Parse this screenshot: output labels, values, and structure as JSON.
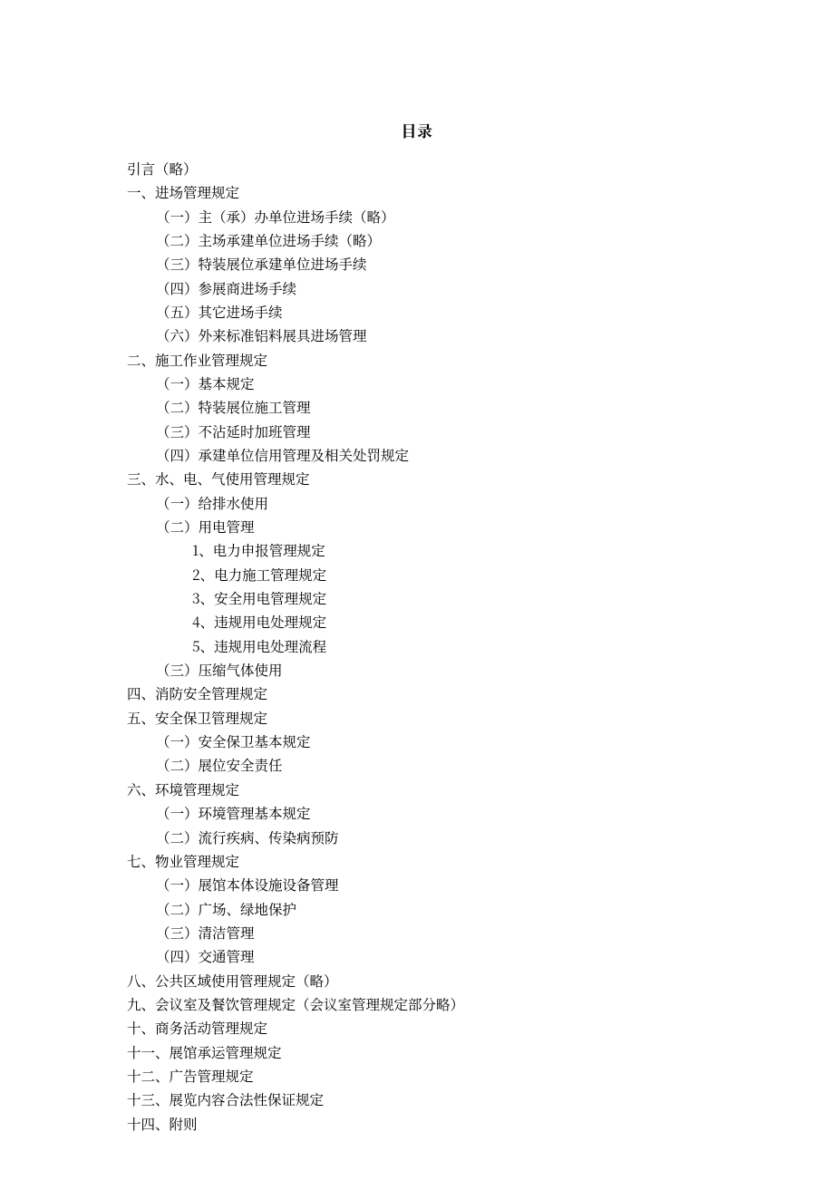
{
  "title": "目录",
  "toc": [
    {
      "level": 0,
      "text": "引言（略）"
    },
    {
      "level": 0,
      "text": "一、进场管理规定"
    },
    {
      "level": 1,
      "text": "（一）主（承）办单位进场手续（略）"
    },
    {
      "level": 1,
      "text": "（二）主场承建单位进场手续（略）"
    },
    {
      "level": 1,
      "text": "（三）特装展位承建单位进场手续"
    },
    {
      "level": 1,
      "text": "（四）参展商进场手续"
    },
    {
      "level": 1,
      "text": "（五）其它进场手续"
    },
    {
      "level": 1,
      "text": "（六）外来标准铝料展具进场管理"
    },
    {
      "level": 0,
      "text": "二、施工作业管理规定"
    },
    {
      "level": 1,
      "text": "（一）基本规定"
    },
    {
      "level": 1,
      "text": "（二）特装展位施工管理"
    },
    {
      "level": 1,
      "text": "（三）不沾延时加班管理"
    },
    {
      "level": 1,
      "text": "（四）承建单位信用管理及相关处罚规定"
    },
    {
      "level": 0,
      "text": "三、水、电、气使用管理规定"
    },
    {
      "level": 1,
      "text": "（一）给排水使用"
    },
    {
      "level": 1,
      "text": "（二）用电管理"
    },
    {
      "level": 2,
      "text": "1、电力申报管理规定"
    },
    {
      "level": 2,
      "text": "2、电力施工管理规定"
    },
    {
      "level": 2,
      "text": "3、安全用电管理规定"
    },
    {
      "level": 2,
      "text": "4、违规用电处理规定"
    },
    {
      "level": 2,
      "text": "5、违规用电处理流程"
    },
    {
      "level": 1,
      "text": "（三）压缩气体使用"
    },
    {
      "level": 0,
      "text": "四、消防安全管理规定"
    },
    {
      "level": 0,
      "text": "五、安全保卫管理规定"
    },
    {
      "level": 1,
      "text": "（一）安全保卫基本规定"
    },
    {
      "level": 1,
      "text": "（二）展位安全责任"
    },
    {
      "level": 0,
      "text": "六、环境管理规定"
    },
    {
      "level": 1,
      "text": "（一）环境管理基本规定"
    },
    {
      "level": 1,
      "text": "（二）流行疾病、传染病预防"
    },
    {
      "level": 0,
      "text": "七、物业管理规定"
    },
    {
      "level": 1,
      "text": "（一）展馆本体设施设备管理"
    },
    {
      "level": 1,
      "text": "（二）广场、绿地保护"
    },
    {
      "level": 1,
      "text": "（三）清洁管理"
    },
    {
      "level": 1,
      "text": "（四）交通管理"
    },
    {
      "level": 0,
      "text": "八、公共区域使用管理规定（略）"
    },
    {
      "level": 0,
      "text": "九、会议室及餐饮管理规定（会议室管理规定部分略）"
    },
    {
      "level": 0,
      "text": "十、商务活动管理规定"
    },
    {
      "level": 0,
      "text": "十一、展馆承运管理规定"
    },
    {
      "level": 0,
      "text": "十二、广告管理规定"
    },
    {
      "level": 0,
      "text": "十三、展览内容合法性保证规定"
    },
    {
      "level": 0,
      "text": "十四、附则"
    }
  ]
}
